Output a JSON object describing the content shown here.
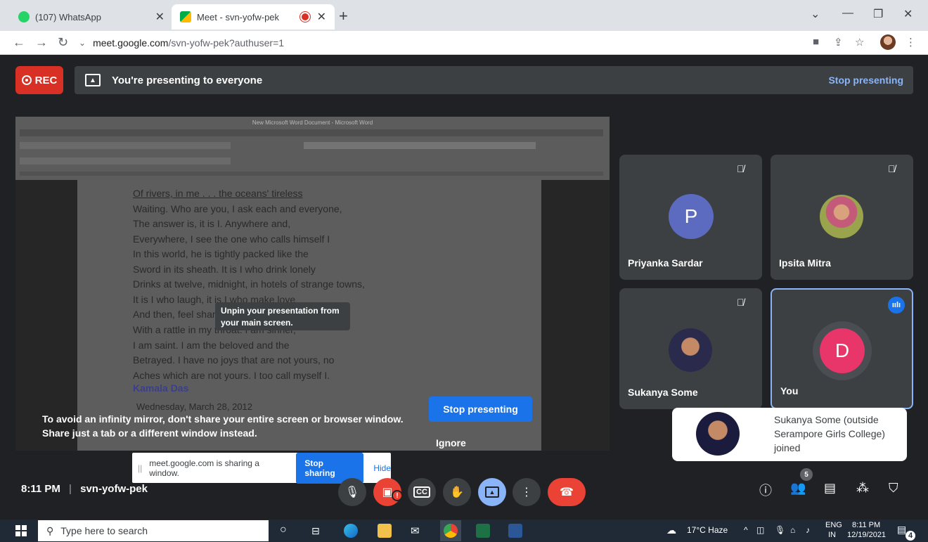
{
  "browser": {
    "tabs": [
      {
        "title": "(107) WhatsApp",
        "icon": "whatsapp-icon"
      },
      {
        "title": "Meet - svn-yofw-pek",
        "icon": "meet-icon",
        "recording": true
      }
    ],
    "url_host": "meet.google.com",
    "url_path": "/svn-yofw-pek?authuser=1"
  },
  "meet": {
    "rec_label": "REC",
    "presenting_message": "You're presenting to everyone",
    "stop_presenting_top": "Stop presenting",
    "stop_presenting_main": "Stop presenting",
    "ignore_label": "Ignore",
    "mirror_warning_line1": "To avoid an infinity mirror, don't share your entire screen or browser window.",
    "mirror_warning_line2": "Share just a tab or a different window instead.",
    "tooltip_line1": "Unpin your presentation from",
    "tooltip_line2": "your main screen.",
    "word_title": "New Microsoft Word Document - Microsoft Word",
    "doc_lines": [
      "Of rivers, in me . . . the oceans' tireless",
      "Waiting. Who are you, I ask each and everyone,",
      "The answer is, it is I. Anywhere and,",
      "Everywhere, I see the one who calls himself I",
      "In this world, he is tightly packed like the",
      "Sword in its sheath. It is I who drink lonely",
      "Drinks at twelve, midnight, in hotels of strange towns,",
      "It is I who laugh, it is I who make love",
      "And then, feel shame, it is I who lie dying",
      "With a rattle in my throat. I am sinner,",
      "I am saint. I am the beloved and the",
      "Betrayed. I have no joys that are not yours, no",
      "Aches which are not yours. I too call myself I."
    ],
    "doc_author": "Kamala Das",
    "doc_date": "Wednesday, March 28, 2012",
    "participants": [
      {
        "name": "Priyanka Sardar",
        "initial": "P",
        "color": "#5c6bc0",
        "muted": true
      },
      {
        "name": "Ipsita Mitra",
        "muted": true
      },
      {
        "name": "Sukanya Some",
        "muted": true
      },
      {
        "name": "You",
        "initial": "D",
        "color": "#e8366a",
        "speaking": true
      }
    ],
    "toast": "Sukanya Some (outside Serampore Girls College) joined",
    "share_bar": {
      "text": "meet.google.com is sharing a window.",
      "stop_label": "Stop sharing",
      "hide_label": "Hide"
    },
    "time": "8:11 PM",
    "separator": "|",
    "meeting_code": "svn-yofw-pek",
    "people_count": "5"
  },
  "taskbar": {
    "search_placeholder": "Type here to search",
    "weather": "17°C  Haze",
    "lang1": "ENG",
    "lang2": "IN",
    "clock_time": "8:11 PM",
    "clock_date": "12/19/2021",
    "notifications": "4"
  },
  "colors": {
    "accent": "#1a73e8",
    "meet_background": "#202124",
    "rec_red": "#d93025"
  }
}
